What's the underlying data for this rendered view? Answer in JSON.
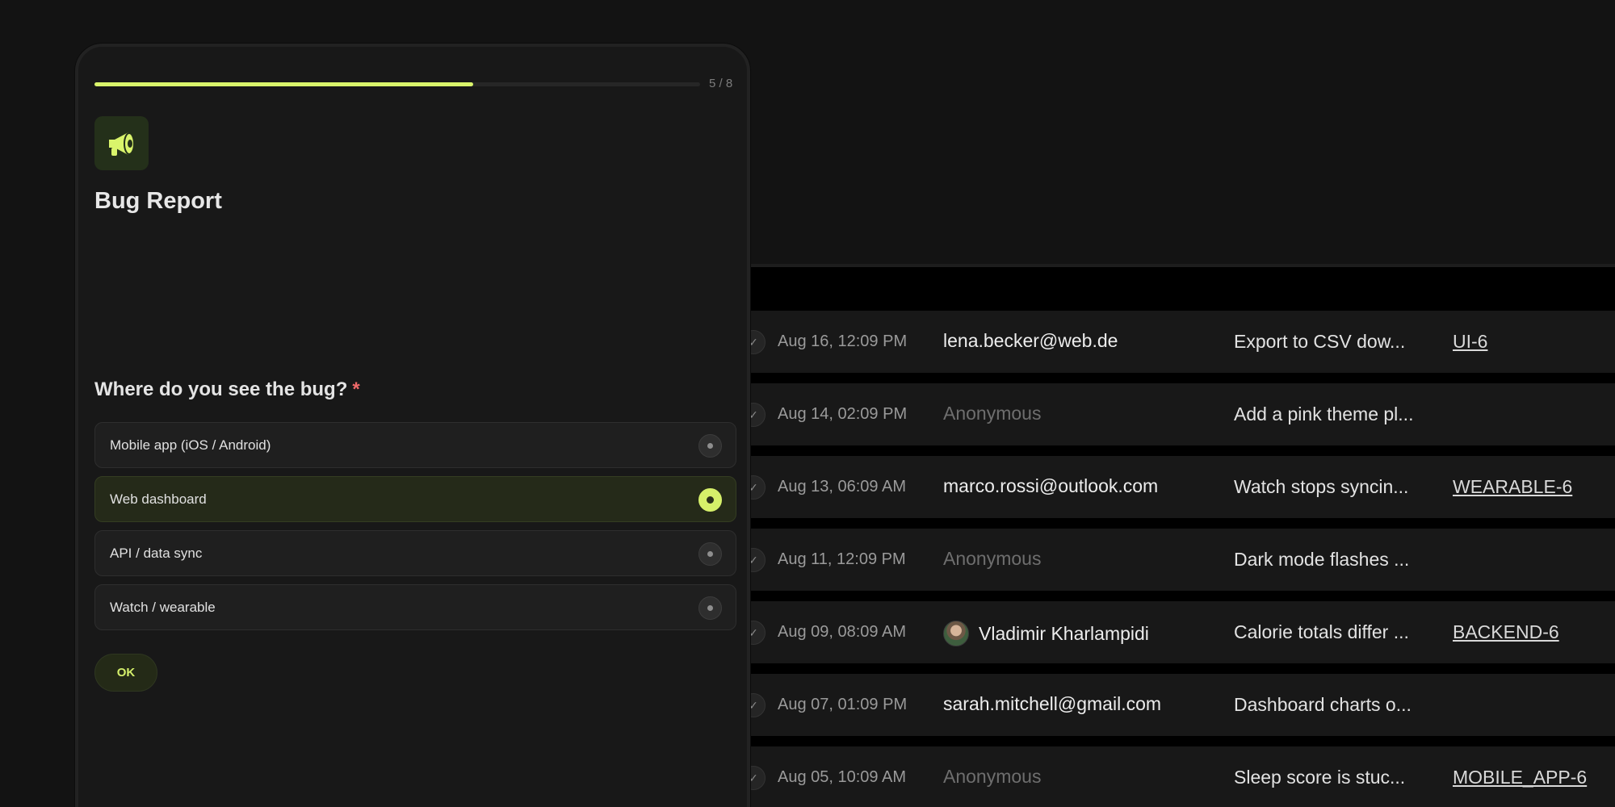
{
  "form": {
    "progress_label": "5 / 8",
    "progress_fraction": 0.625,
    "logo_icon": "megaphone-icon",
    "title": "Bug Report",
    "question": "Where do you see the bug?",
    "required_mark": "*",
    "options": [
      {
        "label": "Mobile app (iOS / Android)",
        "selected": false
      },
      {
        "label": "Web dashboard",
        "selected": true
      },
      {
        "label": "API / data sync",
        "selected": false
      },
      {
        "label": "Watch / wearable",
        "selected": false
      }
    ],
    "ok_label": "OK",
    "accent_color": "#d9f46b"
  },
  "table": {
    "rows": [
      {
        "date": "Aug 16, 12:09 PM",
        "user": "lena.becker@web.de",
        "anonymous": false,
        "avatar": false,
        "title": "Export to CSV dow...",
        "ticket": "UI-6"
      },
      {
        "date": "Aug 14, 02:09 PM",
        "user": "Anonymous",
        "anonymous": true,
        "avatar": false,
        "title": "Add a pink theme pl...",
        "ticket": ""
      },
      {
        "date": "Aug 13, 06:09 AM",
        "user": "marco.rossi@outlook.com",
        "anonymous": false,
        "avatar": false,
        "title": "Watch stops syncin...",
        "ticket": "WEARABLE-6"
      },
      {
        "date": "Aug 11, 12:09 PM",
        "user": "Anonymous",
        "anonymous": true,
        "avatar": false,
        "title": "Dark mode flashes ...",
        "ticket": ""
      },
      {
        "date": "Aug 09, 08:09 AM",
        "user": "Vladimir Kharlampidi",
        "anonymous": false,
        "avatar": true,
        "title": "Calorie totals differ ...",
        "ticket": "BACKEND-6"
      },
      {
        "date": "Aug 07, 01:09 PM",
        "user": "sarah.mitchell@gmail.com",
        "anonymous": false,
        "avatar": false,
        "title": "Dashboard charts o...",
        "ticket": ""
      },
      {
        "date": "Aug 05, 10:09 AM",
        "user": "Anonymous",
        "anonymous": true,
        "avatar": false,
        "title": "Sleep score is stuc...",
        "ticket": "MOBILE_APP-6"
      }
    ]
  }
}
